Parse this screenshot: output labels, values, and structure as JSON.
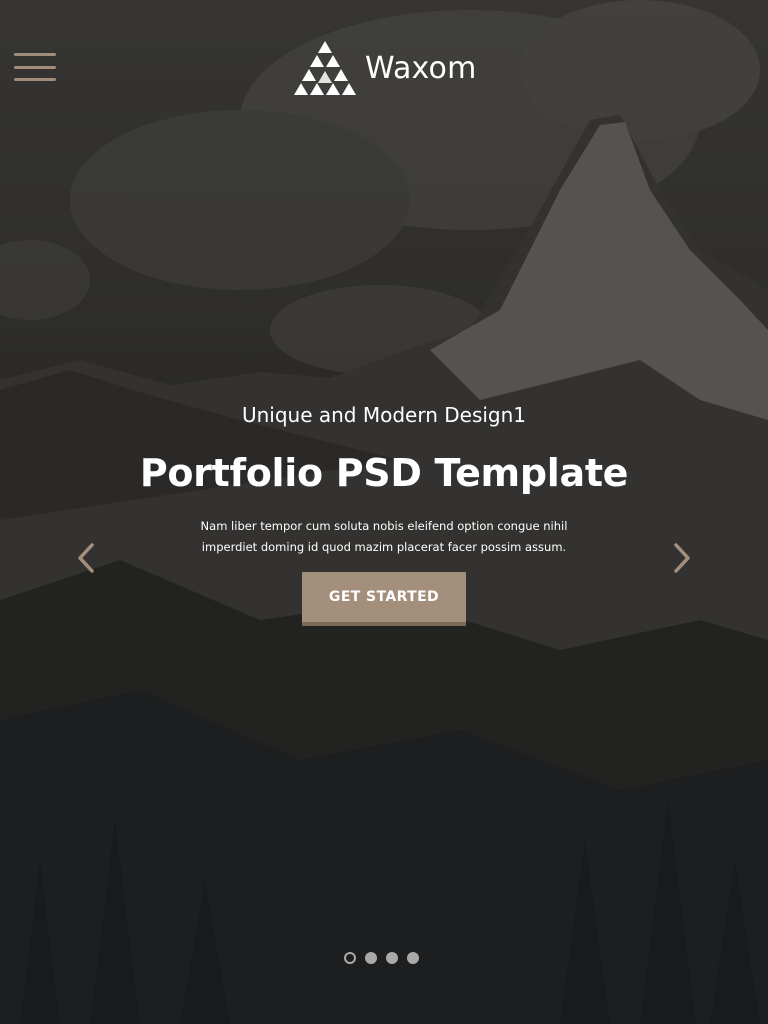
{
  "header": {
    "brand": "Waxom",
    "menu_icon": "hamburger-menu-icon",
    "logo_icon": "triangle-logo-icon"
  },
  "slide": {
    "subtitle": "Unique and Modern Design1",
    "title": "Portfolio PSD Template",
    "description_line1": "Nam liber tempor cum soluta nobis eleifend option congue nihil",
    "description_line2": "imperdiet doming id quod mazim placerat facer possim assum.",
    "cta_label": "GET STARTED"
  },
  "slider": {
    "prev_icon": "chevron-left-icon",
    "next_icon": "chevron-right-icon",
    "dots": [
      {
        "active": true
      },
      {
        "active": false
      },
      {
        "active": false
      },
      {
        "active": false
      }
    ]
  },
  "colors": {
    "accent": "#a48f7c",
    "accent_dark": "#7c6a59",
    "text": "#ffffff",
    "dot": "#a9a9a9"
  }
}
